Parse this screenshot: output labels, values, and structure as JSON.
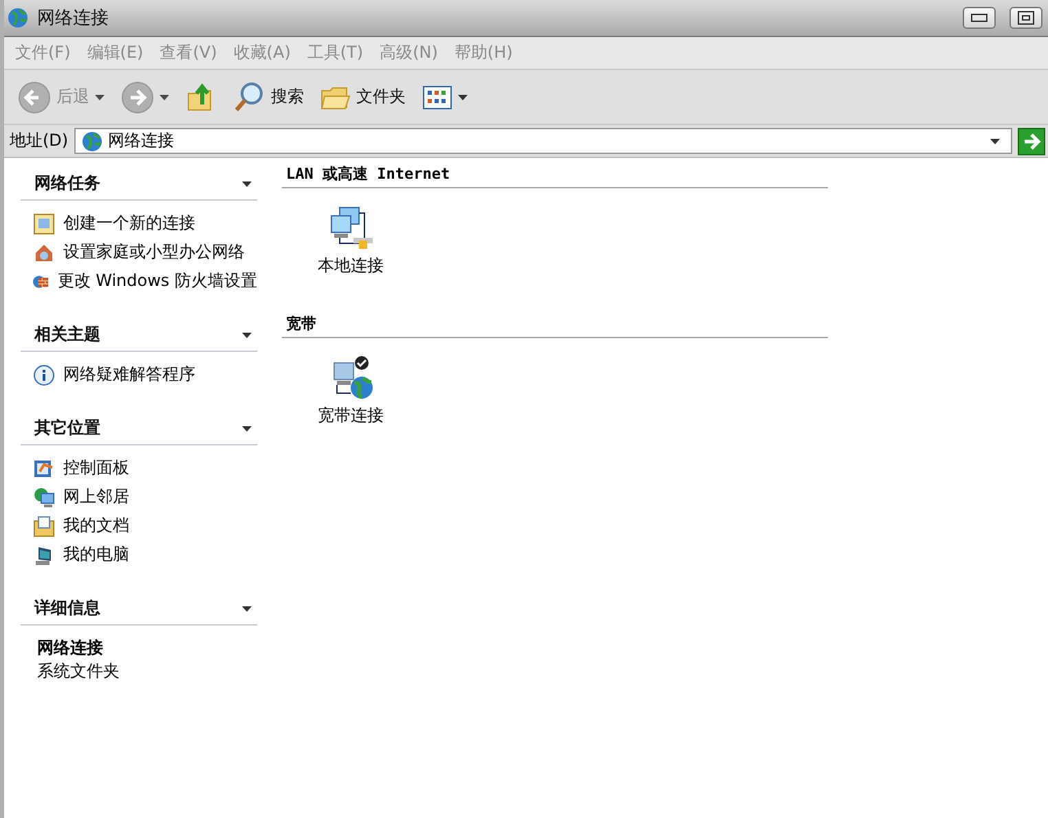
{
  "window": {
    "title": "网络连接"
  },
  "menu": [
    "文件(F)",
    "编辑(E)",
    "查看(V)",
    "收藏(A)",
    "工具(T)",
    "高级(N)",
    "帮助(H)"
  ],
  "toolbar": [
    {
      "kind": "back",
      "label": "后退",
      "disabled": true
    },
    {
      "kind": "forward",
      "disabled": true
    },
    {
      "kind": "up",
      "disabled": false
    },
    {
      "kind": "search",
      "label": "搜索",
      "disabled": false
    },
    {
      "kind": "folders",
      "label": "文件夹",
      "disabled": false
    },
    {
      "kind": "views",
      "disabled": false
    }
  ],
  "address": {
    "label": "地址(D)",
    "value": "网络连接"
  },
  "task_panels": [
    {
      "title": "网络任务",
      "expanded": true,
      "items": [
        {
          "kind": "new",
          "label": "创建一个新的连接"
        },
        {
          "kind": "home",
          "label": "设置家庭或小型办公网络"
        },
        {
          "kind": "firewall",
          "label": "更改 Windows 防火墙设置"
        }
      ]
    },
    {
      "title": "相关主题",
      "expanded": true,
      "items": [
        {
          "kind": "info",
          "label": "网络疑难解答程序"
        }
      ]
    },
    {
      "title": "其它位置",
      "expanded": true,
      "items": [
        {
          "kind": "control",
          "label": "控制面板"
        },
        {
          "kind": "neighborhood",
          "label": "网上邻居"
        },
        {
          "kind": "documents",
          "label": "我的文档"
        },
        {
          "kind": "computer",
          "label": "我的电脑"
        }
      ]
    },
    {
      "title": "详细信息",
      "expanded": true,
      "details": {
        "name": "网络连接",
        "type": "系统文件夹"
      }
    }
  ],
  "groups": [
    {
      "title": "LAN 或高速 Internet",
      "connections": [
        {
          "kind": "lan",
          "label": "本地连接"
        }
      ]
    },
    {
      "title": "宽带",
      "connections": [
        {
          "kind": "broadband",
          "label": "宽带连接"
        }
      ]
    }
  ]
}
